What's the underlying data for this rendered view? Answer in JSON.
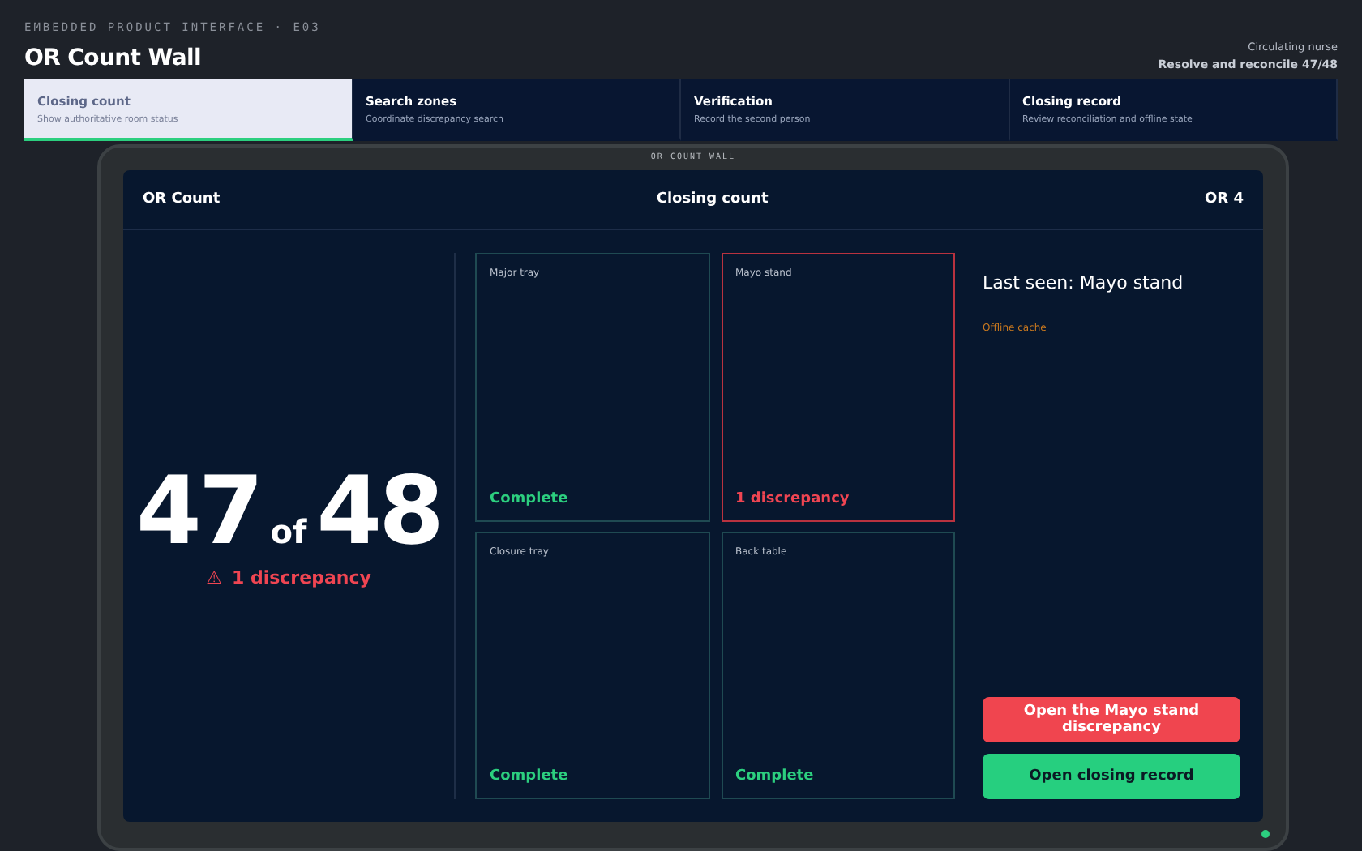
{
  "eyebrow": "EMBEDDED PRODUCT INTERFACE · E03",
  "title": "OR Count Wall",
  "role": {
    "label": "Circulating nurse",
    "task": "Resolve and reconcile 47/48"
  },
  "tabs": [
    {
      "label": "Closing count",
      "sub": "Show authoritative room status",
      "selected": true
    },
    {
      "label": "Search zones",
      "sub": "Coordinate discrepancy search",
      "selected": false
    },
    {
      "label": "Verification",
      "sub": "Record the second person",
      "selected": false
    },
    {
      "label": "Closing record",
      "sub": "Review reconciliation and offline state",
      "selected": false
    }
  ],
  "device": {
    "label": "OR COUNT WALL",
    "led_on": true
  },
  "screen": {
    "left": "OR Count",
    "center": "Closing count",
    "right": "OR 4"
  },
  "count": {
    "counted": "47",
    "of": "of",
    "total": "48",
    "alert_icon": "⚠",
    "alert": "1 discrepancy"
  },
  "zones": [
    {
      "name": "Major tray",
      "status": "Complete",
      "kind": "complete"
    },
    {
      "name": "Mayo stand",
      "status": "1 discrepancy",
      "kind": "discrepancy"
    },
    {
      "name": "Closure tray",
      "status": "Complete",
      "kind": "complete"
    },
    {
      "name": "Back table",
      "status": "Complete",
      "kind": "complete"
    }
  ],
  "side": {
    "last_seen": "Last seen: Mayo stand",
    "cache": "Offline cache"
  },
  "buttons": [
    {
      "label": "Open the Mayo stand discrepancy",
      "kind": "danger"
    },
    {
      "label": "Open closing record",
      "kind": "primary"
    }
  ]
}
